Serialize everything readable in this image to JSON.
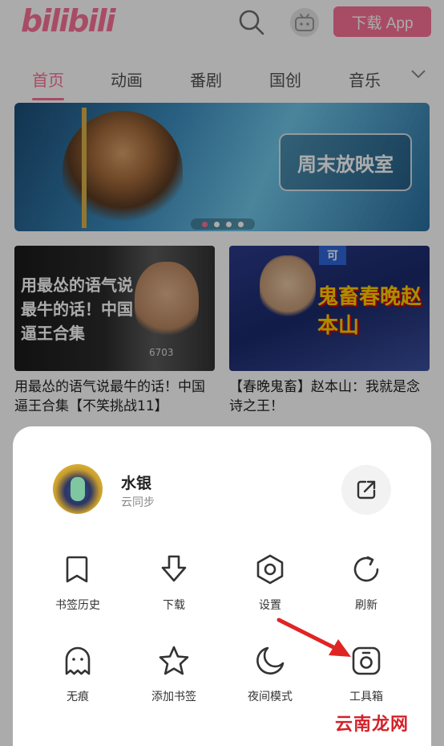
{
  "header": {
    "logo_text": "bilibili",
    "download_label": "下载 App",
    "brand_color": "#fb7299",
    "search_icon": "search-icon",
    "avatar_icon": "tv-avatar-icon"
  },
  "nav": {
    "tabs": [
      {
        "label": "首页",
        "active": true
      },
      {
        "label": "动画",
        "active": false
      },
      {
        "label": "番剧",
        "active": false
      },
      {
        "label": "国创",
        "active": false
      },
      {
        "label": "音乐",
        "active": false
      }
    ],
    "more_icon": "chevron-down-icon"
  },
  "banner": {
    "tag_text": "周末放映室",
    "page_count": 4,
    "active_index": 0
  },
  "videos": [
    {
      "thumb_text": "用最怂的语气说最牛的话！中国逼王合集",
      "thumb_count": "6703",
      "title": "用最怂的语气说最牛的话！中国逼王合集【不笑挑战11】"
    },
    {
      "thumb_corner": "可",
      "thumb_text": "鬼畜春晚赵本山",
      "title": "【春晚鬼畜】赵本山：我就是念诗之王！"
    }
  ],
  "sheet": {
    "user": {
      "name": "水银",
      "subtitle": "云同步"
    },
    "share_icon": "share-out-icon",
    "menu": [
      {
        "label": "书签历史",
        "icon": "bookmark-icon"
      },
      {
        "label": "下载",
        "icon": "download-icon"
      },
      {
        "label": "设置",
        "icon": "settings-hexagon-icon"
      },
      {
        "label": "刷新",
        "icon": "refresh-icon"
      },
      {
        "label": "无痕",
        "icon": "ghost-icon"
      },
      {
        "label": "添加书签",
        "icon": "star-icon"
      },
      {
        "label": "夜间模式",
        "icon": "moon-icon"
      },
      {
        "label": "工具箱",
        "icon": "toolbox-icon"
      }
    ]
  },
  "annotation": {
    "arrow_color": "#e02424"
  },
  "watermark": "云南龙网"
}
